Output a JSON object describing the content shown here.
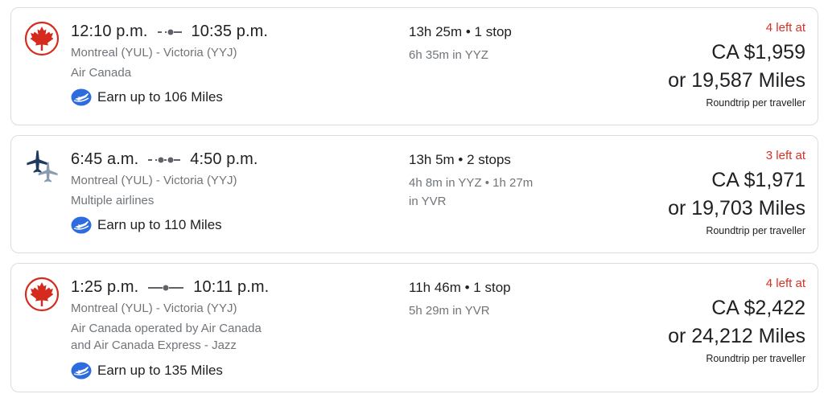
{
  "flights": [
    {
      "depart": "12:10 p.m.",
      "arrive": "10:35 p.m.",
      "route": "Montreal (YUL) - Victoria (YYJ)",
      "airline": "Air Canada",
      "airline_line2": "",
      "miles": "Earn up to 106 Miles",
      "duration": "13h 25m • 1 stop",
      "layover": "6h 35m in YYZ",
      "seats_left": "4 left at",
      "price": "CA $1,959",
      "price_miles": "or 19,587 Miles",
      "price_note": "Roundtrip per traveller",
      "logo": "air-canada-maple-leaf-icon"
    },
    {
      "depart": "6:45 a.m.",
      "arrive": "4:50 p.m.",
      "route": "Montreal (YUL) - Victoria (YYJ)",
      "airline": "Multiple airlines",
      "airline_line2": "",
      "miles": "Earn up to 110 Miles",
      "duration": "13h 5m • 2 stops",
      "layover": "4h 8m in YYZ • 1h 27m in YVR",
      "seats_left": "3 left at",
      "price": "CA $1,971",
      "price_miles": "or 19,703 Miles",
      "price_note": "Roundtrip per traveller",
      "logo": "multiple-airlines-planes-icon"
    },
    {
      "depart": "1:25 p.m.",
      "arrive": "10:11 p.m.",
      "route": "Montreal (YUL) - Victoria (YYJ)",
      "airline": "Air Canada operated by Air Canada",
      "airline_line2": "and Air Canada Express - Jazz",
      "miles": "Earn up to 135 Miles",
      "duration": "11h 46m • 1 stop",
      "layover": "5h 29m in YVR",
      "seats_left": "4 left at",
      "price": "CA $2,422",
      "price_miles": "or 24,212 Miles",
      "price_note": "Roundtrip per traveller",
      "logo": "air-canada-maple-leaf-icon"
    }
  ],
  "colors": {
    "seats_left": "#d93025",
    "air_canada_red": "#d52b1e",
    "aeroplan_blue": "#2d6cdf",
    "plane_navy": "#1f3a5f",
    "plane_gray": "#8a9bb0",
    "muted_text": "#70757a"
  }
}
